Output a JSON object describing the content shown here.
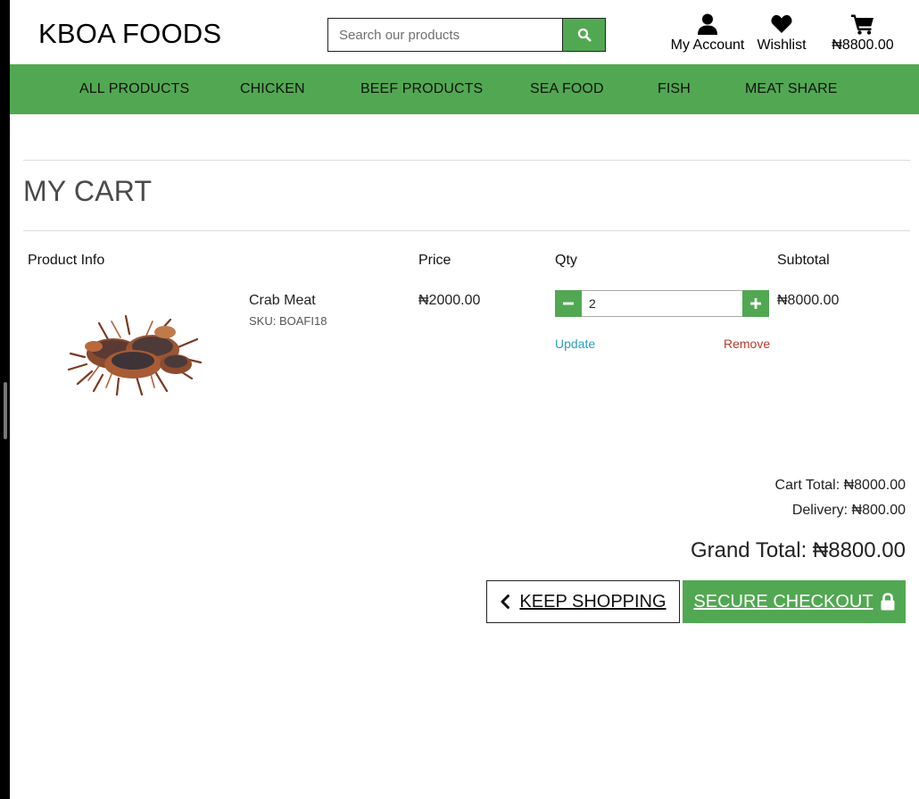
{
  "header": {
    "brand": "KBOA FOODS",
    "search_placeholder": "Search our products",
    "account_label": "My Account",
    "wishlist_label": "Wishlist",
    "bag_total": "₦8800.00"
  },
  "nav": {
    "items": [
      "ALL PRODUCTS",
      "CHICKEN",
      "BEEF PRODUCTS",
      "SEA FOOD",
      "FISH",
      "MEAT SHARE"
    ]
  },
  "cart": {
    "title": "MY CART",
    "columns": {
      "product_info": "Product Info",
      "price": "Price",
      "qty": "Qty",
      "subtotal": "Subtotal"
    },
    "items": [
      {
        "name": "Crab Meat",
        "sku": "SKU: BOAFI18",
        "price": "₦2000.00",
        "qty": "2",
        "subtotal": "₦8000.00",
        "update_label": "Update",
        "remove_label": "Remove"
      }
    ],
    "cart_total": "Cart Total: ₦8000.00",
    "delivery": "Delivery: ₦800.00",
    "grand_total": "Grand Total: ₦8800.00",
    "keep_shopping_label": "KEEP SHOPPING",
    "checkout_label": "SECURE CHECKOUT"
  },
  "icons": {
    "search": "search-icon",
    "account": "user-icon",
    "wishlist": "heart-icon",
    "bag": "shopping-cart-icon",
    "minus": "minus-icon",
    "plus": "plus-icon",
    "back": "chevron-left-icon",
    "lock": "lock-icon"
  },
  "colors": {
    "accent_green": "#52a852",
    "link_blue": "#2a9fc3",
    "remove_red": "#c0392b"
  }
}
